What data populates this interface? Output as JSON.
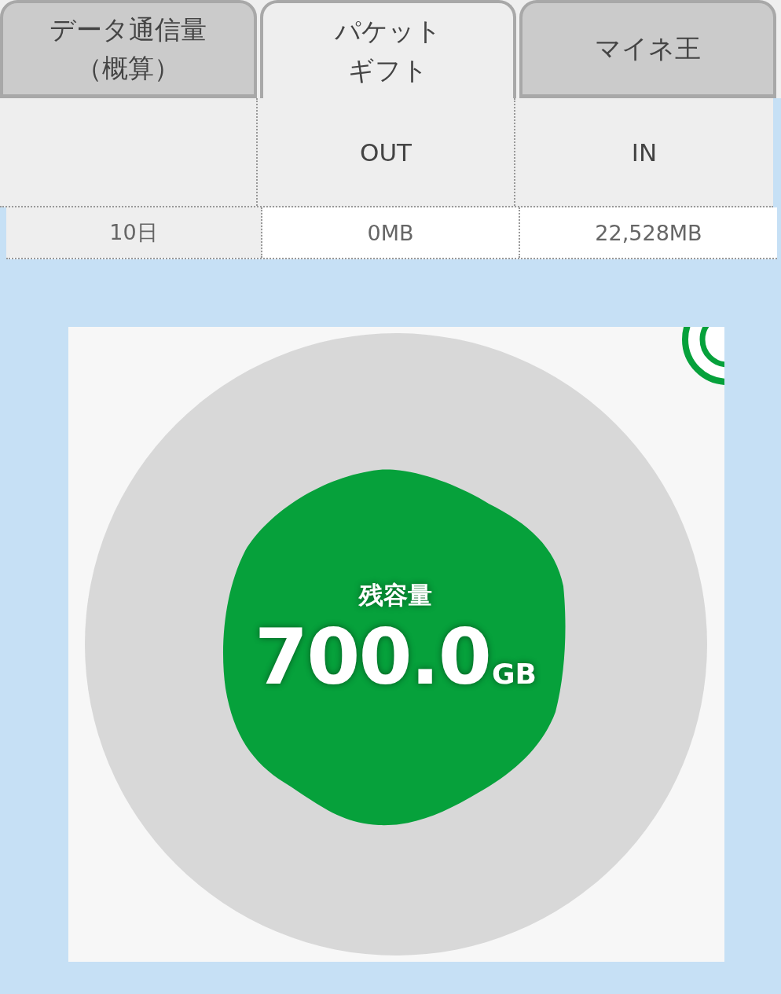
{
  "tabs": [
    {
      "lines": [
        "データ通信量",
        "（概算）"
      ],
      "selected": false
    },
    {
      "lines": [
        "パケット",
        "ギフト"
      ],
      "selected": true
    },
    {
      "lines": [
        "マイネ王"
      ],
      "selected": false
    }
  ],
  "table": {
    "header": [
      "OUT",
      "IN"
    ],
    "rows": [
      {
        "cells": [
          "10日",
          "0MB",
          "22,528MB"
        ]
      }
    ]
  },
  "remaining": {
    "label": "残容量",
    "value": "700.0",
    "unit": "GB"
  }
}
